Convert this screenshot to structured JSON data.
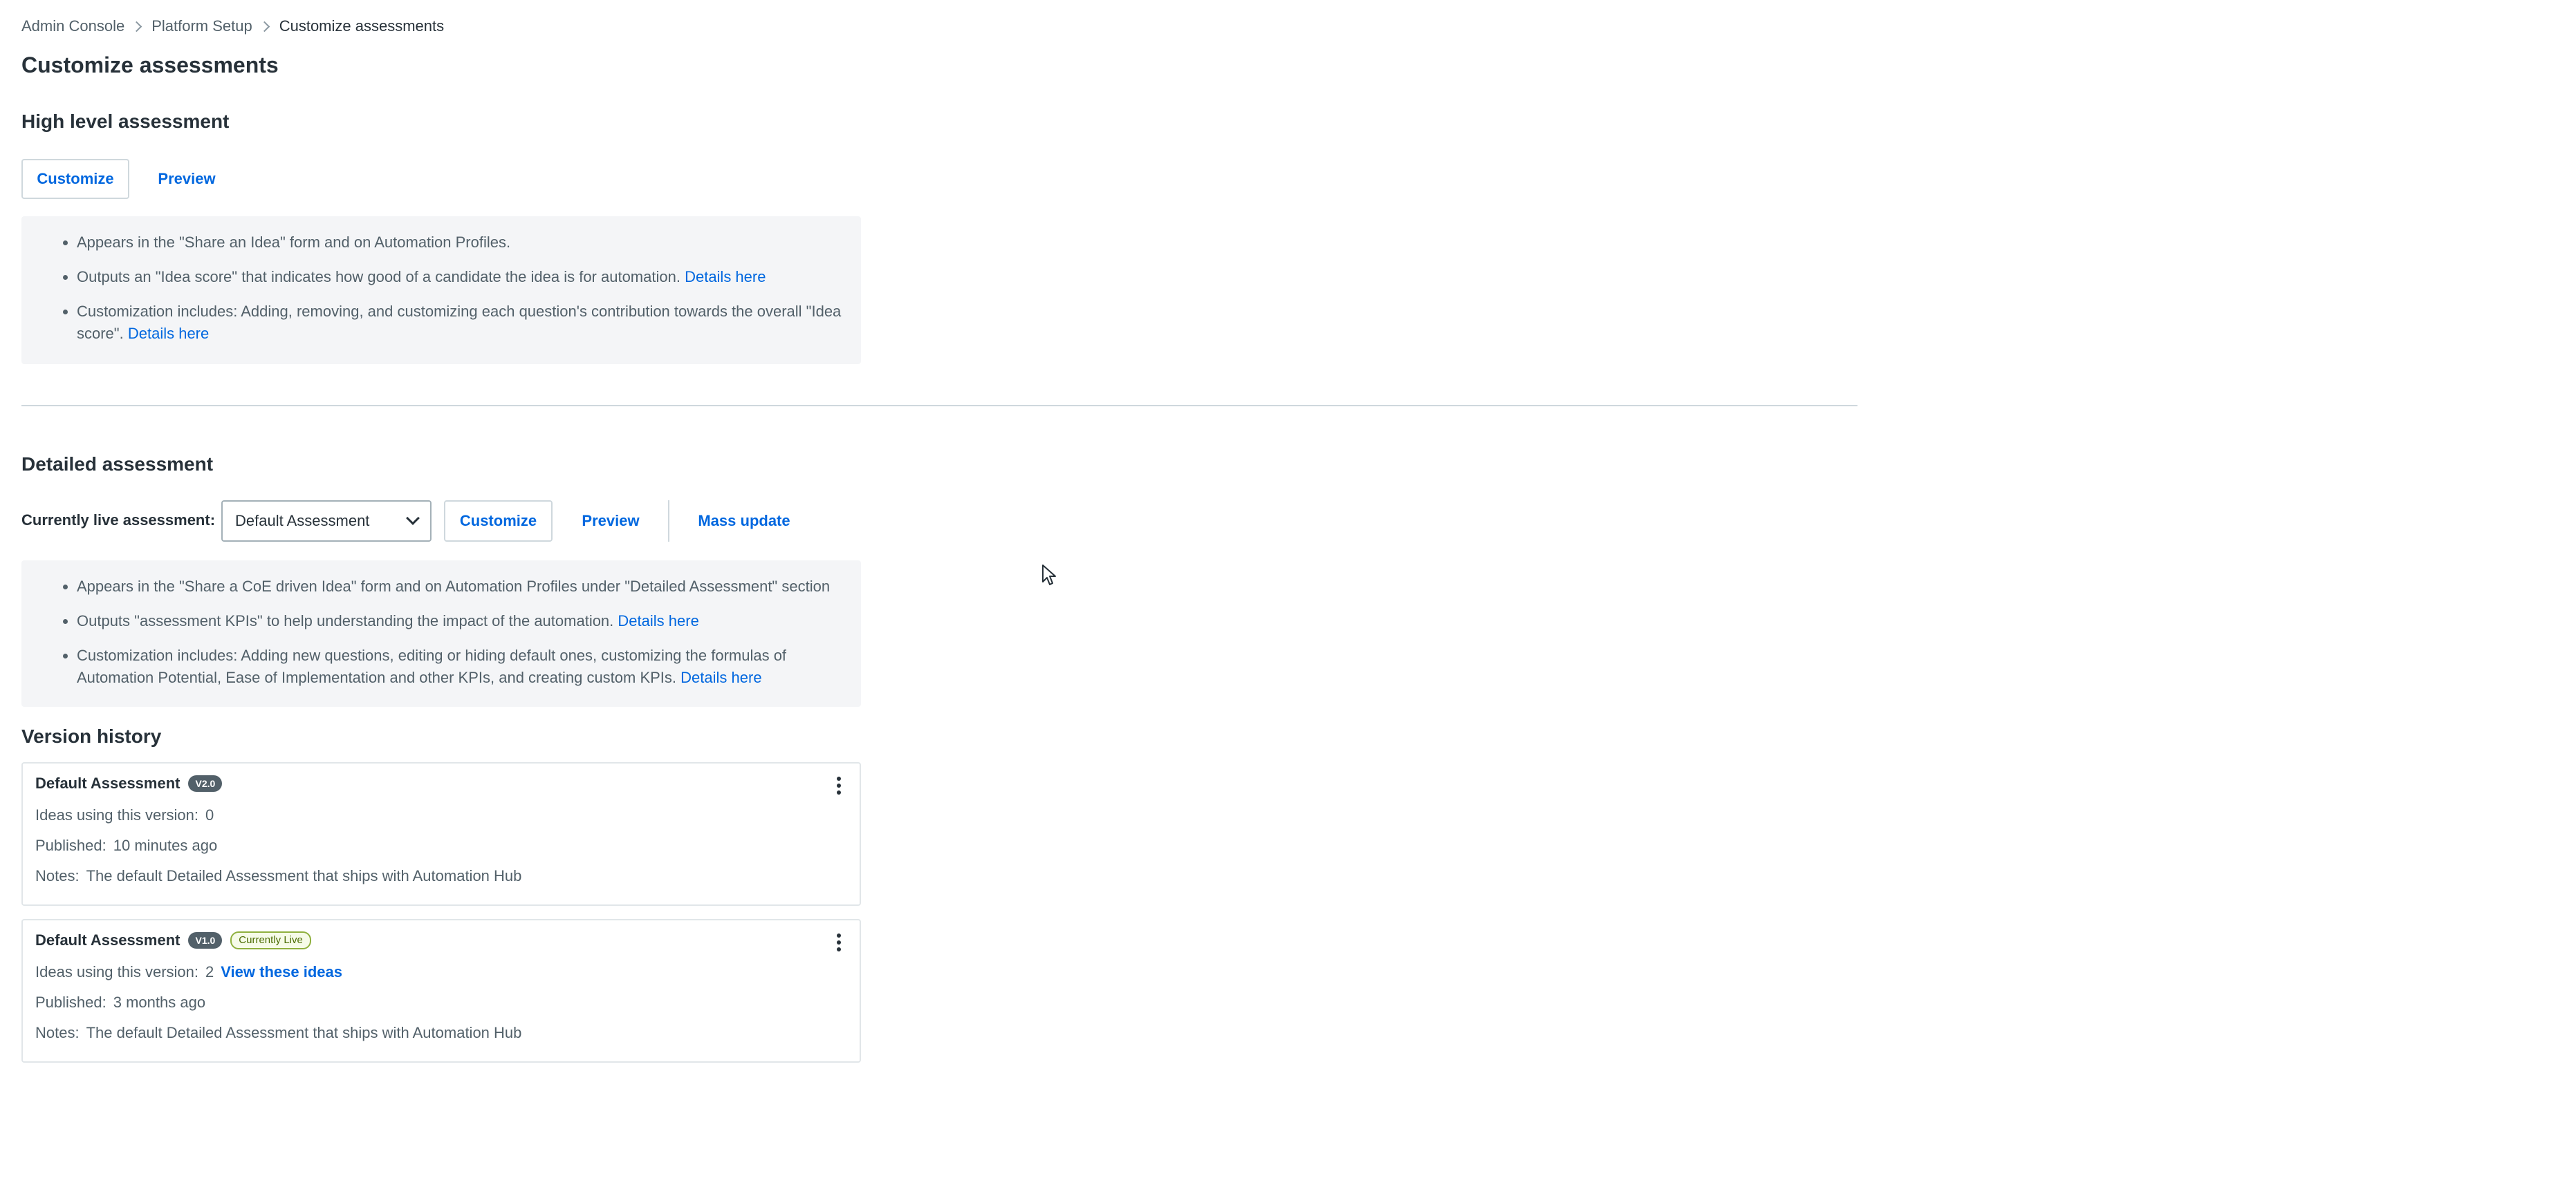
{
  "breadcrumb": {
    "items": [
      "Admin Console",
      "Platform Setup",
      "Customize assessments"
    ]
  },
  "page_title": "Customize assessments",
  "high_level": {
    "title": "High level assessment",
    "customize_label": "Customize",
    "preview_label": "Preview",
    "info": {
      "item1": "Appears in the \"Share an Idea\" form and on Automation Profiles.",
      "item2": "Outputs an \"Idea score\" that indicates how good of a candidate the idea is for automation.",
      "item2_link": "Details here",
      "item3": "Customization includes: Adding, removing, and customizing each question's contribution towards the overall \"Idea score\".",
      "item3_link": "Details here"
    }
  },
  "detailed": {
    "title": "Detailed assessment",
    "live_label": "Currently live assessment:",
    "select_value": "Default Assessment",
    "customize_label": "Customize",
    "preview_label": "Preview",
    "mass_update_label": "Mass update",
    "info": {
      "item1": "Appears in the \"Share a CoE driven Idea\" form and on Automation Profiles under \"Detailed Assessment\" section",
      "item2": "Outputs \"assessment KPIs\" to help understanding the impact of the automation.",
      "item2_link": "Details here",
      "item3": "Customization includes: Adding new questions, editing or hiding default ones, customizing the formulas of Automation Potential, Ease of Implementation and other KPIs, and creating custom KPIs.",
      "item3_link": "Details here"
    }
  },
  "version_history": {
    "title": "Version history",
    "versions": [
      {
        "name": "Default Assessment",
        "version": "V2.0",
        "live_badge": "",
        "ideas_label": "Ideas using this version:",
        "ideas_count": "0",
        "ideas_link": "",
        "published_label": "Published:",
        "published_value": "10 minutes ago",
        "notes_label": "Notes:",
        "notes_value": "The default Detailed Assessment that ships with Automation Hub"
      },
      {
        "name": "Default Assessment",
        "version": "V1.0",
        "live_badge": "Currently Live",
        "ideas_label": "Ideas using this version:",
        "ideas_count": "2",
        "ideas_link": "View these ideas",
        "published_label": "Published:",
        "published_value": "3 months ago",
        "notes_label": "Notes:",
        "notes_value": "The default Detailed Assessment that ships with Automation Hub"
      }
    ]
  },
  "colors": {
    "link": "#0067df",
    "text_primary": "#273139",
    "text_secondary": "#526069",
    "info_bg": "#f4f5f7",
    "live_badge_border": "#8fb03e"
  }
}
